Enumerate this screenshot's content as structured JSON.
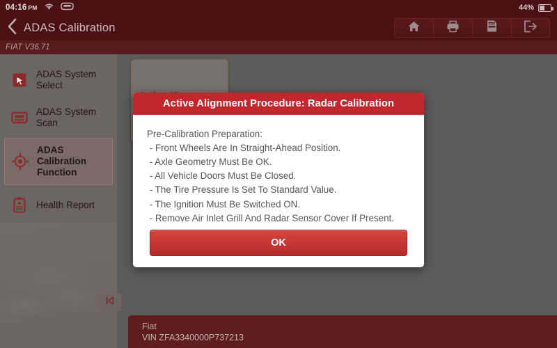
{
  "status_bar": {
    "time": "04:16",
    "ampm": "PM",
    "wifi_icon": "wifi-icon",
    "vci_icon": "vci-connector-icon",
    "battery_percent": "44%",
    "battery_level": 44
  },
  "title_bar": {
    "back_icon": "back-chevron-icon",
    "title": "ADAS Calibration",
    "buttons": [
      {
        "name": "home-button",
        "icon": "home-icon"
      },
      {
        "name": "print-button",
        "icon": "printer-icon"
      },
      {
        "name": "adas-report-button",
        "icon": "adas-report-icon",
        "icon_text": "ADAS"
      },
      {
        "name": "exit-button",
        "icon": "exit-icon"
      }
    ]
  },
  "version_bar": {
    "text": "FIAT V36.71"
  },
  "sidebar": {
    "items": [
      {
        "label": "ADAS System Select",
        "icon": "cursor-select-icon",
        "selected": false
      },
      {
        "label": "ADAS System Scan",
        "icon": "scan-window-icon",
        "selected": false
      },
      {
        "label": "ADAS Calibration Function",
        "icon": "crosshair-target-icon",
        "selected": true
      },
      {
        "label": "Health Report",
        "icon": "clipboard-report-icon",
        "selected": false
      }
    ]
  },
  "content": {
    "card": {
      "label": "Active Alignment",
      "name": "active-alignment-card"
    },
    "collapse_button": {
      "icon": "skip-back-icon",
      "name": "sidebar-collapse-button"
    },
    "vehicle": {
      "make": "Fiat",
      "vin": "VIN ZFA3340000P737213"
    }
  },
  "dialog": {
    "title": "Active Alignment Procedure: Radar Calibration",
    "lines": [
      "Pre-Calibration Preparation:",
      " - Front Wheels Are In Straight-Ahead Position.",
      " - Axle Geometry Must Be OK.",
      " - All Vehicle Doors Must Be Closed.",
      " - The Tire Pressure Is Set To Standard Value.",
      " - The Ignition Must Be Switched ON.",
      " - Remove Air Inlet Grill And Radar Sensor Cover If Present."
    ],
    "ok_label": "OK"
  },
  "colors": {
    "header_maroon": "#4a1013",
    "version_bar": "#571a1d",
    "dialog_red": "#c1272d",
    "ok_button_top": "#d8453f",
    "ok_button_bottom": "#b42a2c",
    "sidebar_grey": "#6b6663",
    "content_grey": "#5b5b5b",
    "vehicle_bar": "#5e1d1f"
  }
}
